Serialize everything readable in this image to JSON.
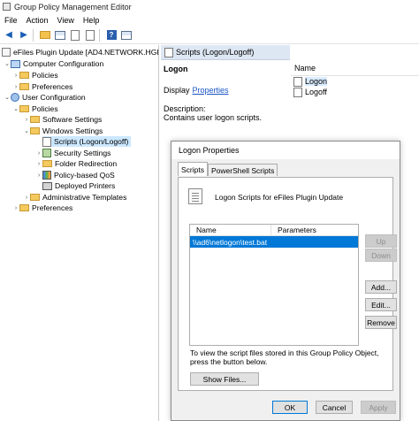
{
  "window": {
    "title": "Group Policy Management Editor"
  },
  "menu": [
    "File",
    "Action",
    "View",
    "Help"
  ],
  "tree": {
    "root": "eFiles Plugin Update [AD4.NETWORK.HGF.C",
    "computer_config": "Computer Configuration",
    "policies_1": "Policies",
    "preferences_1": "Preferences",
    "user_config": "User Configuration",
    "policies_2": "Policies",
    "software_settings": "Software Settings",
    "windows_settings": "Windows Settings",
    "scripts": "Scripts (Logon/Logoff)",
    "security_settings": "Security Settings",
    "folder_redirection": "Folder Redirection",
    "policy_qos": "Policy-based QoS",
    "deployed_printers": "Deployed Printers",
    "admin_templates": "Administrative Templates",
    "preferences_2": "Preferences"
  },
  "right": {
    "header": "Scripts (Logon/Logoff)",
    "policy_title": "Logon",
    "display_label": "Display",
    "display_link": "Properties",
    "desc_label": "Description:",
    "desc_text": "Contains user logon scripts.",
    "name_header": "Name",
    "items": [
      "Logon",
      "Logoff"
    ]
  },
  "dialog": {
    "title": "Logon Properties",
    "tabs": [
      "Scripts",
      "PowerShell Scripts"
    ],
    "heading": "Logon Scripts for eFiles Plugin Update",
    "col_name": "Name",
    "col_params": "Parameters",
    "script_name": "\\\\ad6\\netlogon\\test.bat",
    "script_params": "",
    "btn_up": "Up",
    "btn_down": "Down",
    "btn_add": "Add...",
    "btn_edit": "Edit...",
    "btn_remove": "Remove",
    "note": "To view the script files stored in this Group Policy Object, press the button below.",
    "btn_show": "Show Files...",
    "btn_ok": "OK",
    "btn_cancel": "Cancel",
    "btn_apply": "Apply"
  }
}
